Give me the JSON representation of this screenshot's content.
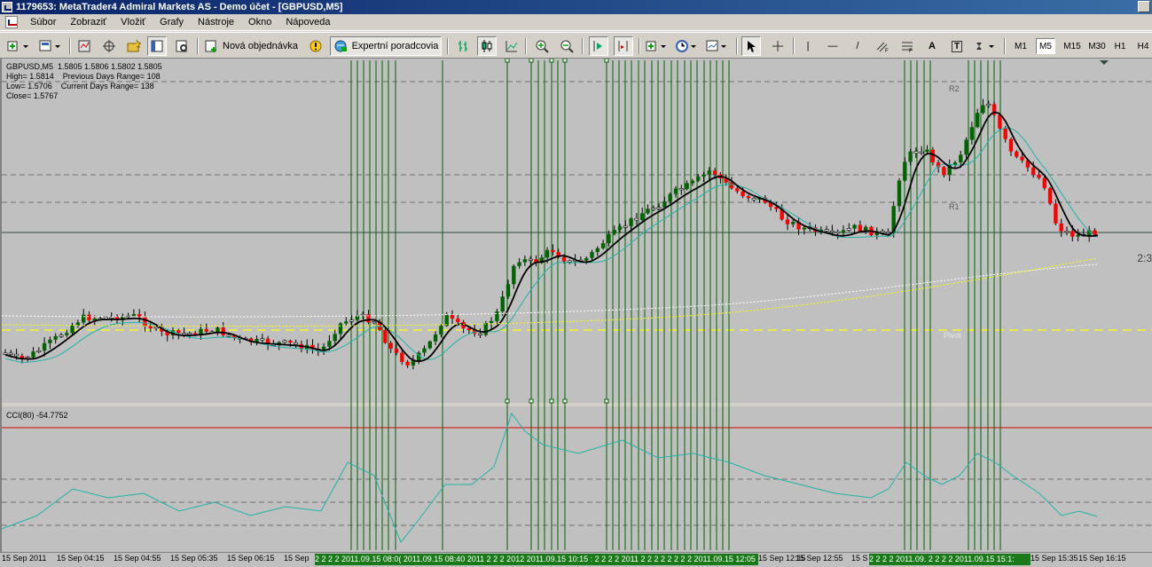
{
  "window": {
    "title": "1179653: MetaTrader4 Admiral Markets AS - Demo účet - [GBPUSD,M5]"
  },
  "menu": [
    "Súbor",
    "Zobraziť",
    "Vložiť",
    "Grafy",
    "Nástroje",
    "Okno",
    "Nápoveda"
  ],
  "toolbar": {
    "new_order_label": "Nová objednávka",
    "expert_label": "Expertní poradcovia",
    "timeframes": [
      "M1",
      "M5",
      "M15",
      "M30",
      "H1",
      "H4"
    ],
    "active_timeframe": "M5",
    "line_tools": [
      "|",
      "—",
      "/",
      "A",
      "T"
    ]
  },
  "info": {
    "line1": "GBPUSD,M5  1.5805 1.5806 1.5802 1.5805",
    "line2": "High= 1.5814    Previous Days Range= 108",
    "line3": "Low= 1.5706    Current Days Range= 138",
    "line4": "Close= 1.5767"
  },
  "levels": {
    "r2": "R2",
    "r1": "R1",
    "pivot": "Pivot",
    "edge": "2:3"
  },
  "cci": {
    "label": "CCI(80) -54.7752"
  },
  "timeaxis": {
    "ticks": [
      "15 Sep 2011",
      "15 Sep 04:15",
      "15 Sep 04:55",
      "15 Sep 05:35",
      "15 Sep 06:15",
      "15 Sep",
      "15 Sep 12:15",
      "15 Sep 12:55",
      "15 S",
      "15 Sep 15:35",
      "15 Sep 16:15"
    ],
    "strip1": "2 2 2 2 2011.09.15 08:0( 2011.09.15 08:40 2011  2 2 2 2012 2011.09.15 10:15 : 2 2 2 2 2011  2 2 2 2 2 2 2 2 2011.09.15 12:05",
    "strip2": "2 2 2 2 2011.09.  2 2 2 2 2011.09.15 15:1:"
  },
  "colors": {
    "bull": "#006400",
    "bear": "#ff0000",
    "ma_fast": "#000000",
    "ma_slow": "#20b2aa",
    "vline": "#006400",
    "pivot": "#ffff00",
    "cci_line": "#20b2aa",
    "chart_bg": "#c0c0c0"
  }
}
